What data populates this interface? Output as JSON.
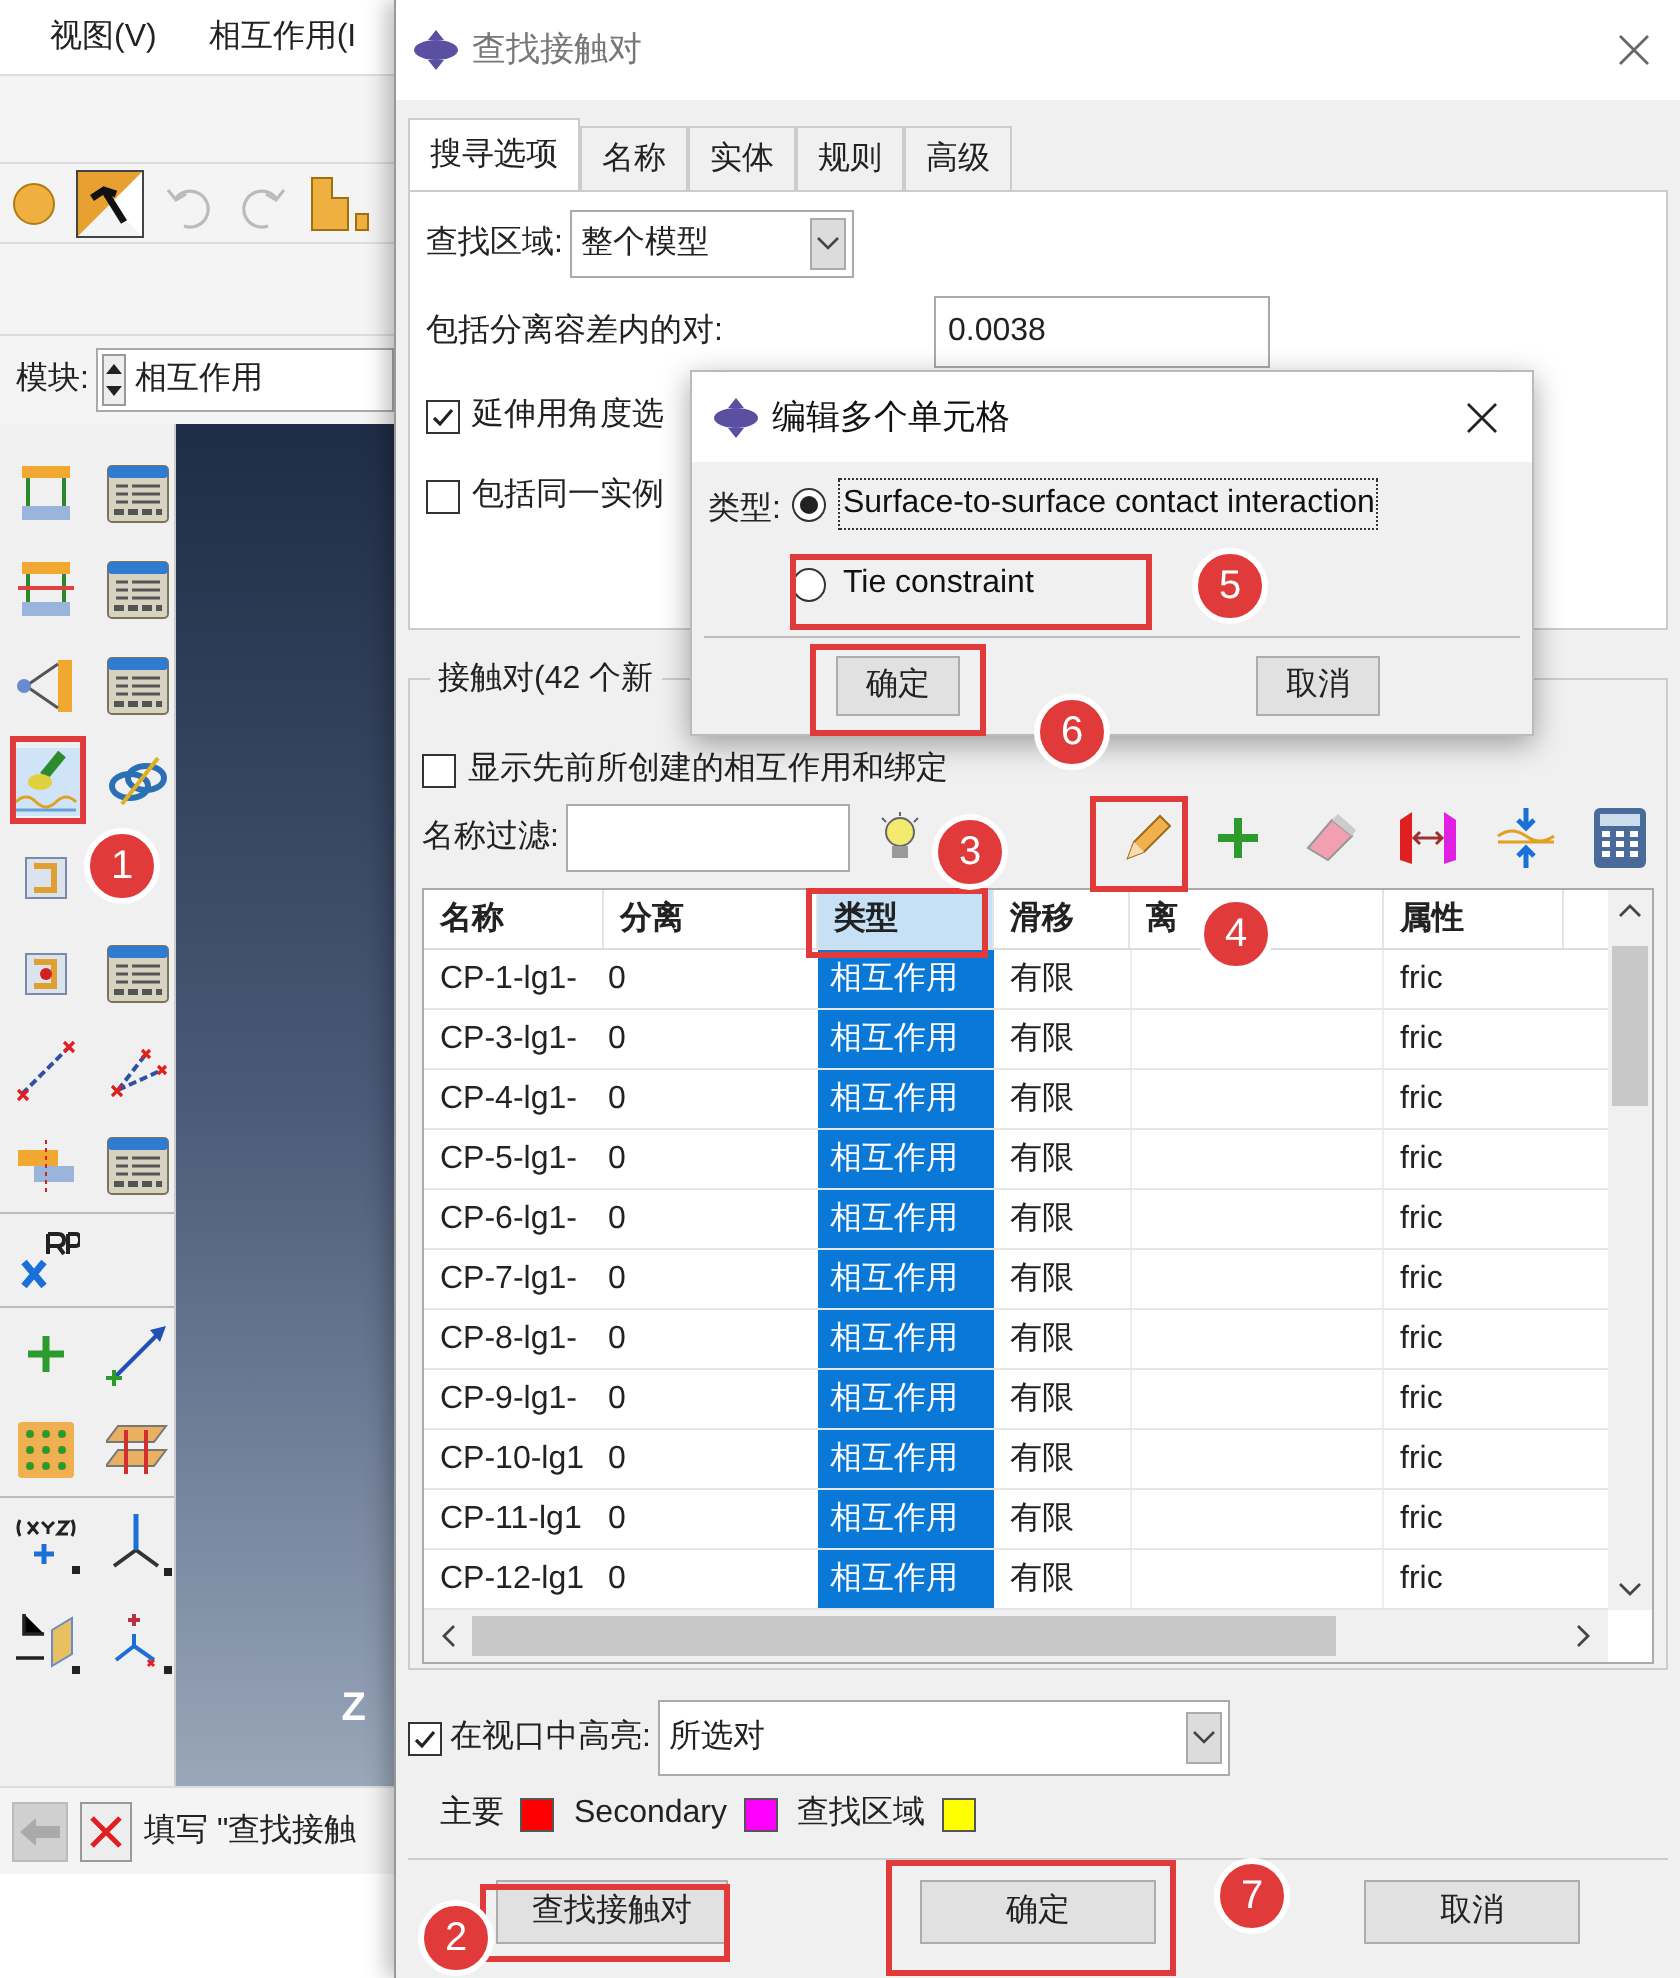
{
  "main_window": {
    "menu": [
      {
        "label": "视图(V)"
      },
      {
        "label": "相互作用(I"
      }
    ],
    "module": {
      "label": "模块:",
      "value": "相互作用"
    },
    "viewport": {
      "axis_label": "Z"
    },
    "prompt": {
      "text": "填写 \"查找接触"
    }
  },
  "find_dialog": {
    "title": "查找接触对",
    "tabs": [
      {
        "label": "搜寻选项",
        "selected": true
      },
      {
        "label": "名称",
        "selected": false
      },
      {
        "label": "实体",
        "selected": false
      },
      {
        "label": "规则",
        "selected": false
      },
      {
        "label": "高级",
        "selected": false
      }
    ],
    "search_domain": {
      "label": "查找区域:",
      "value": "整个模型"
    },
    "tolerance": {
      "label": "包括分离容差内的对:",
      "value": "0.0038"
    },
    "options": [
      {
        "label": "延伸用角度选",
        "checked": true
      },
      {
        "label": "包括同一实例",
        "checked": false
      }
    ],
    "pairs_group": {
      "title": "接触对(42 个新",
      "show_previous": {
        "label": "显示先前所创建的相互作用和绑定",
        "checked": false
      },
      "name_filter": {
        "label": "名称过滤:"
      },
      "columns": [
        {
          "label": "名称",
          "selected": false
        },
        {
          "label": "分离",
          "selected": false
        },
        {
          "label": "类型",
          "selected": true
        },
        {
          "label": "滑移",
          "selected": false
        },
        {
          "label": "离",
          "selected": false
        },
        {
          "label": "属性",
          "selected": false
        }
      ],
      "rows": [
        {
          "name": "CP-1-lg1-",
          "separation": "0",
          "type": {
            "text": "相互作用",
            "selected": true
          },
          "sliding": "有限",
          "property": "fric"
        },
        {
          "name": "CP-3-lg1-",
          "separation": "0",
          "type": {
            "text": "相互作用",
            "selected": true
          },
          "sliding": "有限",
          "property": "fric"
        },
        {
          "name": "CP-4-lg1-",
          "separation": "0",
          "type": {
            "text": "相互作用",
            "selected": true
          },
          "sliding": "有限",
          "property": "fric"
        },
        {
          "name": "CP-5-lg1-",
          "separation": "0",
          "type": {
            "text": "相互作用",
            "selected": true
          },
          "sliding": "有限",
          "property": "fric"
        },
        {
          "name": "CP-6-lg1-",
          "separation": "0",
          "type": {
            "text": "相互作用",
            "selected": true
          },
          "sliding": "有限",
          "property": "fric"
        },
        {
          "name": "CP-7-lg1-",
          "separation": "0",
          "type": {
            "text": "相互作用",
            "selected": true
          },
          "sliding": "有限",
          "property": "fric"
        },
        {
          "name": "CP-8-lg1-",
          "separation": "0",
          "type": {
            "text": "相互作用",
            "selected": true
          },
          "sliding": "有限",
          "property": "fric"
        },
        {
          "name": "CP-9-lg1-",
          "separation": "0",
          "type": {
            "text": "相互作用",
            "selected": true
          },
          "sliding": "有限",
          "property": "fric"
        },
        {
          "name": "CP-10-lg1",
          "separation": "0",
          "type": {
            "text": "相互作用",
            "selected": true
          },
          "sliding": "有限",
          "property": "fric"
        },
        {
          "name": "CP-11-lg1",
          "separation": "0",
          "type": {
            "text": "相互作用",
            "selected": true
          },
          "sliding": "有限",
          "property": "fric"
        },
        {
          "name": "CP-12-lg1",
          "separation": "0",
          "type": {
            "text": "相互作用",
            "selected": true
          },
          "sliding": "有限",
          "property": "fric"
        }
      ]
    },
    "highlight": {
      "label": "在视口中高亮:",
      "checked": true,
      "value": "所选对"
    },
    "legend": [
      {
        "label": "主要",
        "color": "#ff0000"
      },
      {
        "label": "Secondary",
        "color": "#ff00ff"
      },
      {
        "label": "查找区域",
        "color": "#ffff00"
      }
    ],
    "buttons": [
      {
        "label": "查找接触对"
      },
      {
        "label": "确定"
      },
      {
        "label": "取消"
      }
    ]
  },
  "edit_dialog": {
    "title": "编辑多个单元格",
    "type_label": "类型:",
    "choices": [
      {
        "label": "Surface-to-surface contact interaction",
        "selected": true
      },
      {
        "label": "Tie constraint",
        "selected": false
      }
    ],
    "buttons": [
      {
        "label": "确定"
      },
      {
        "label": "取消"
      }
    ]
  },
  "callouts": [
    {
      "label": "5"
    },
    {
      "label": "6"
    },
    {
      "label": "1"
    },
    {
      "label": "3"
    },
    {
      "label": "4"
    },
    {
      "label": "7"
    },
    {
      "label": "2"
    }
  ]
}
